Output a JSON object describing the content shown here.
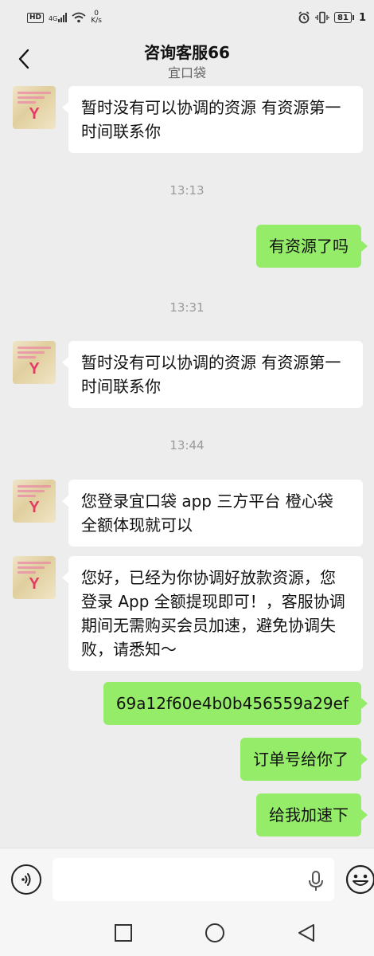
{
  "status_bar": {
    "hd": "HD",
    "net_type": "4G",
    "speed_value": "0",
    "speed_unit": "K/s",
    "battery": "81",
    "time_partial": "1"
  },
  "header": {
    "title": "咨询客服66",
    "subtitle": "宜口袋"
  },
  "messages": [
    {
      "type": "incoming",
      "text": "暂时没有可以协调的资源  有资源第一时间联系你"
    },
    {
      "type": "time",
      "text": "13:13"
    },
    {
      "type": "outgoing",
      "text": "有资源了吗"
    },
    {
      "type": "time",
      "text": "13:31"
    },
    {
      "type": "incoming",
      "text": "暂时没有可以协调的资源  有资源第一时间联系你"
    },
    {
      "type": "time",
      "text": "13:44"
    },
    {
      "type": "incoming",
      "text": "您登录宜口袋 app 三方平台  橙心袋 全额体现就可以"
    },
    {
      "type": "incoming",
      "text": "您好，已经为你协调好放款资源，您登录 App 全额提现即可！，客服协调期间无需购买会员加速，避免协调失败，请悉知～"
    },
    {
      "type": "outgoing",
      "text": "69a12f60e4b0b456559a29ef"
    },
    {
      "type": "outgoing",
      "text": "订单号给你了"
    },
    {
      "type": "outgoing",
      "text": "给我加速下"
    }
  ],
  "input": {
    "value": "",
    "placeholder": ""
  },
  "icons": {
    "back": "chevron-left-icon",
    "voice": "voice-icon",
    "mic": "microphone-icon",
    "emoji": "emoji-icon",
    "nav_recent": "square-icon",
    "nav_home": "circle-icon",
    "nav_back": "triangle-back-icon"
  },
  "colors": {
    "background": "#ededed",
    "outgoing_bubble": "#95ec69",
    "incoming_bubble": "#ffffff",
    "timestamp": "#9a9a9a"
  }
}
